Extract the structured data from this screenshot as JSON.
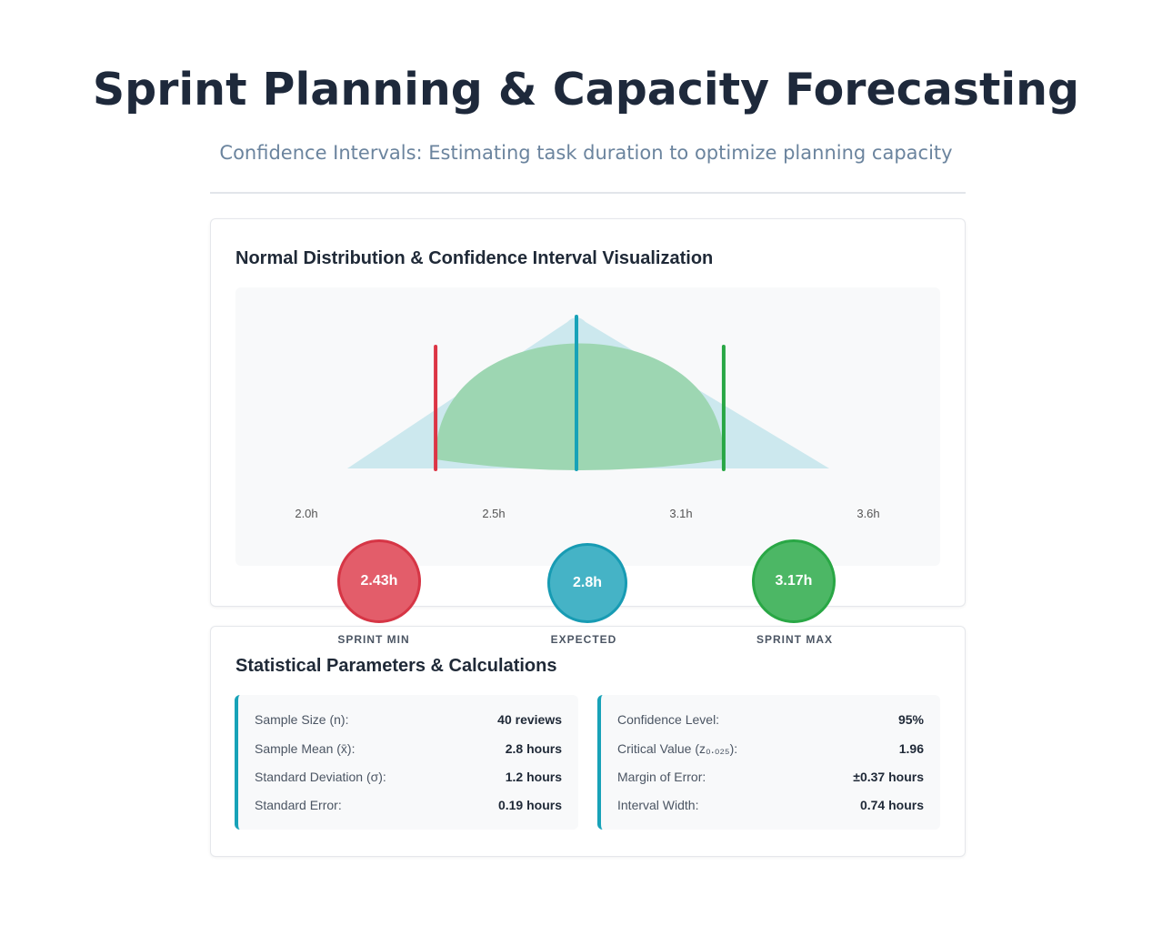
{
  "header": {
    "title": "Sprint Planning & Capacity Forecasting",
    "subtitle": "Confidence Intervals: Estimating task duration to optimize planning capacity"
  },
  "visualization": {
    "title": "Normal Distribution & Confidence Interval Visualization",
    "x_ticks": [
      "2.0h",
      "2.5h",
      "3.1h",
      "3.6h"
    ],
    "colors": {
      "distribution_fill": "#cce8ee",
      "interval_fill": "#9dd6b2",
      "min_line": "#dc3545",
      "mean_line": "#17a2b8",
      "max_line": "#28a745"
    },
    "markers": {
      "min": {
        "value": "2.43h",
        "caption": "SPRINT MIN"
      },
      "expected": {
        "value": "2.8h",
        "caption": "EXPECTED"
      },
      "max": {
        "value": "3.17h",
        "caption": "SPRINT MAX"
      }
    }
  },
  "chart_data": {
    "type": "area",
    "xlim": [
      2.0,
      3.6
    ],
    "x_ticks": [
      2.0,
      2.5,
      3.1,
      3.6
    ],
    "mean": 2.8,
    "interval": [
      2.43,
      3.17
    ],
    "lines": [
      {
        "name": "SPRINT MIN",
        "x": 2.43
      },
      {
        "name": "EXPECTED",
        "x": 2.8
      },
      {
        "name": "SPRINT MAX",
        "x": 3.17
      }
    ],
    "grid": false
  },
  "stats": {
    "title": "Statistical Parameters & Calculations",
    "left": [
      {
        "label": "Sample Size (n):",
        "value": "40 reviews"
      },
      {
        "label": "Sample Mean (x̄):",
        "value": "2.8 hours"
      },
      {
        "label": "Standard Deviation (σ):",
        "value": "1.2 hours"
      },
      {
        "label": "Standard Error:",
        "value": "0.19 hours"
      }
    ],
    "right": [
      {
        "label": "Confidence Level:",
        "value": "95%"
      },
      {
        "label": "Critical Value (z₀.₀₂₅):",
        "value": "1.96"
      },
      {
        "label": "Margin of Error:",
        "value": "±0.37 hours"
      },
      {
        "label": "Interval Width:",
        "value": "0.74 hours"
      }
    ]
  }
}
